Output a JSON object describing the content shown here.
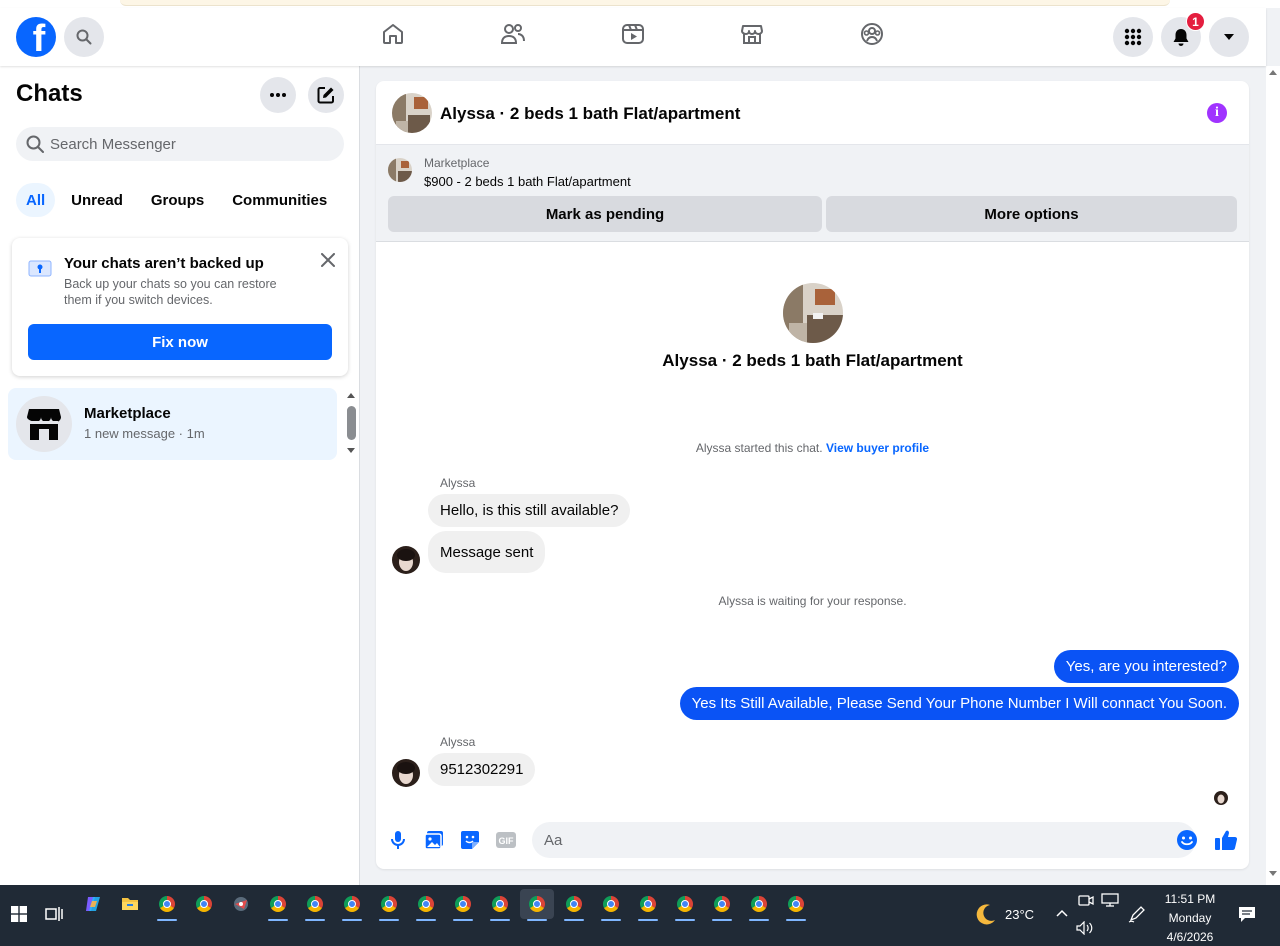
{
  "header": {
    "logo_letter": "f",
    "notifications_count": "1"
  },
  "sidebar": {
    "title": "Chats",
    "search_placeholder": "Search Messenger",
    "filters": [
      "All",
      "Unread",
      "Groups",
      "Communities"
    ],
    "backup": {
      "title": "Your chats aren’t backed up",
      "body": "Back up your chats so you can restore them if you switch devices.",
      "button": "Fix now"
    },
    "chats": [
      {
        "name": "Marketplace",
        "preview": "1 new message · 1m"
      }
    ]
  },
  "conversation": {
    "title": "Alyssa · 2 beds 1 bath Flat/apartment",
    "marketplace_label": "Marketplace",
    "listing": "$900 - 2 beds 1 bath Flat/apartment",
    "mark_pending": "Mark as pending",
    "more_options": "More options",
    "started_text": "Alyssa started this chat.",
    "view_profile": "View buyer profile",
    "waiting_text": "Alyssa is waiting for your response.",
    "sender_name": "Alyssa",
    "messages_in_1": [
      "Hello, is this still available?",
      "Message sent"
    ],
    "messages_out": [
      "Yes, are you interested?",
      "Yes Its Still Available, Please Send Your Phone Number I Will connact You Soon."
    ],
    "messages_in_2": [
      "9512302291"
    ],
    "input_placeholder": "Aa"
  },
  "taskbar": {
    "temperature": "23°C",
    "time": "11:51 PM",
    "day": "Monday",
    "date": "4/6/2026"
  },
  "colors": {
    "brand_blue": "#0866ff",
    "outgoing_bubble": "#0a53f5",
    "info_purple": "#a033ff",
    "badge_red": "#e41e3f"
  }
}
